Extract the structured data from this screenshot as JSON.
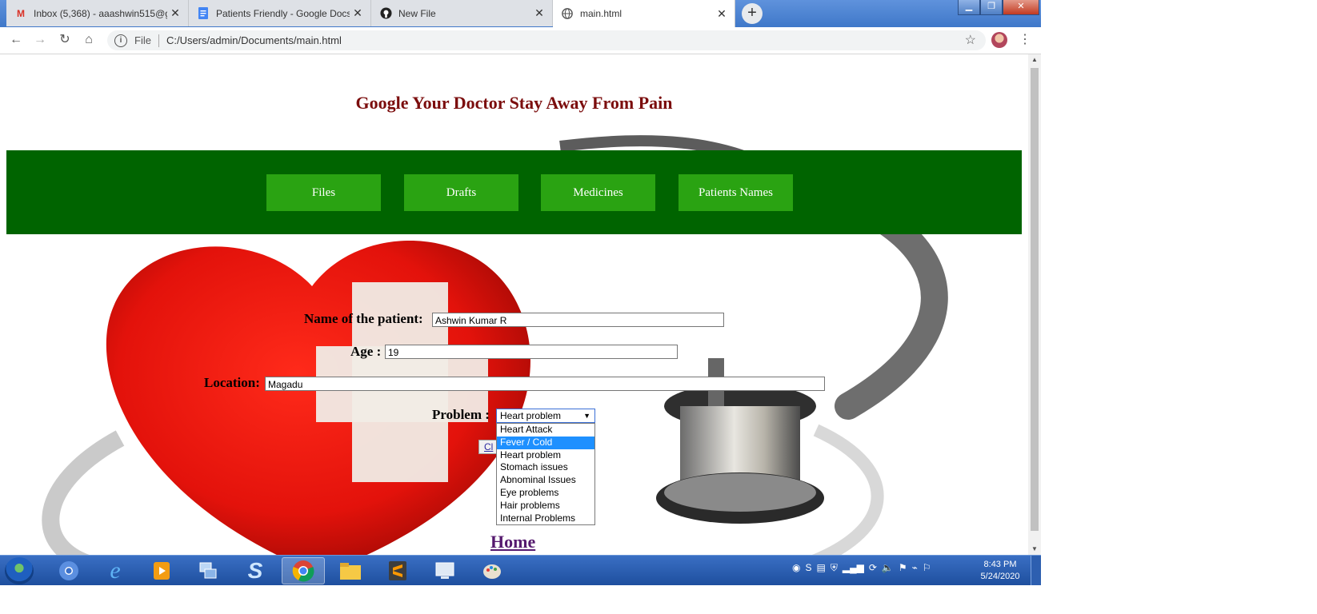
{
  "browser": {
    "tabs": [
      {
        "title": "Inbox (5,368) - aaashwin515@gm",
        "icon": "gmail-icon"
      },
      {
        "title": "Patients Friendly - Google Docs",
        "icon": "docs-icon"
      },
      {
        "title": "New File",
        "icon": "github-icon"
      },
      {
        "title": "main.html",
        "icon": "globe-icon"
      }
    ],
    "address": {
      "protocol": "File",
      "url": "C:/Users/admin/Documents/main.html"
    }
  },
  "page": {
    "heading": "Google Your Doctor Stay Away From Pain",
    "nav": [
      "Files",
      "Drafts",
      "Medicines",
      "Patients Names"
    ],
    "form": {
      "name_label": "Name of the patient:",
      "name_value": "Ashwin Kumar R",
      "age_label": "Age :",
      "age_value": "19",
      "location_label": "Location:",
      "location_value": "Magadu",
      "problem_label": "Problem :",
      "problem_selected": "Heart problem",
      "problem_options": [
        "Heart Attack",
        "Fever / Cold",
        "Heart problem",
        "Stomach issues",
        "Abnominal Issues",
        "Eye problems",
        "Hair problems",
        "Internal Problems"
      ],
      "problem_highlighted": "Fever / Cold",
      "submit_label": "Cl"
    },
    "home_link": "Home"
  },
  "taskbar": {
    "time": "8:43 PM",
    "date": "5/24/2020"
  },
  "colors": {
    "heading": "#7b0d0d",
    "navbar": "#006400",
    "nav_button": "#2aa312",
    "home_link": "#55196e"
  }
}
